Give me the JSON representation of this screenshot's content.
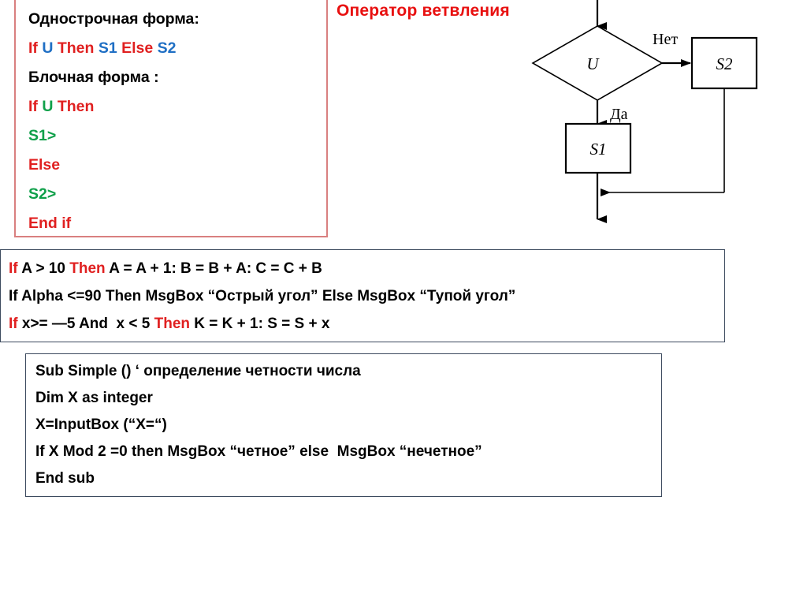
{
  "syntax_box": {
    "border_color": "#d98080",
    "lines": [
      {
        "id": "single-form-heading",
        "tokens": [
          {
            "t": "Однострочная форма:",
            "c": "black"
          }
        ]
      },
      {
        "id": "single-form-code",
        "tokens": [
          {
            "t": "If ",
            "c": "red"
          },
          {
            "t": "U ",
            "c": "blue"
          },
          {
            "t": "Then ",
            "c": "red"
          },
          {
            "t": "S1 ",
            "c": "blue"
          },
          {
            "t": "Else ",
            "c": "red"
          },
          {
            "t": "S2",
            "c": "blue"
          }
        ]
      },
      {
        "id": "block-form-heading",
        "tokens": [
          {
            "t": "Блочная форма :",
            "c": "black"
          }
        ]
      },
      {
        "id": "block-if-then",
        "tokens": [
          {
            "t": "If ",
            "c": "red"
          },
          {
            "t": "U ",
            "c": "green"
          },
          {
            "t": "Then",
            "c": "red"
          }
        ]
      },
      {
        "id": "block-s1",
        "tokens": [
          {
            "t": "S1>",
            "c": "green"
          }
        ]
      },
      {
        "id": "block-else",
        "tokens": [
          {
            "t": "Else",
            "c": "red"
          }
        ]
      },
      {
        "id": "block-s2",
        "tokens": [
          {
            "t": "S2>",
            "c": "green"
          }
        ]
      },
      {
        "id": "block-end-if",
        "tokens": [
          {
            "t": "End if",
            "c": "red"
          }
        ]
      }
    ]
  },
  "flowchart": {
    "title": "Оператор ветвления",
    "title_color": "#e81010",
    "condition_label": "U",
    "true_branch_label": "Да",
    "false_branch_label": "Нет",
    "true_block_label": "S1",
    "false_block_label": "S2",
    "stroke_color": "#000000"
  },
  "examples_box": {
    "border_color": "#3c4a5e",
    "lines": [
      {
        "id": "example-1",
        "tokens": [
          {
            "t": "If ",
            "c": "red"
          },
          {
            "t": "A > 10 ",
            "c": "black"
          },
          {
            "t": "Then ",
            "c": "red"
          },
          {
            "t": "A = A + 1: B = B + A: C = C + B",
            "c": "black"
          }
        ]
      },
      {
        "id": "example-2",
        "tokens": [
          {
            "t": "If Alpha <=90 Then MsgBox “Острый угол” Else MsgBox “Тупой угол”",
            "c": "black"
          }
        ]
      },
      {
        "id": "example-3",
        "tokens": [
          {
            "t": "If ",
            "c": "red"
          },
          {
            "t": "x>= —5 And  x < 5 ",
            "c": "black"
          },
          {
            "t": "Then ",
            "c": "red"
          },
          {
            "t": "K = K + 1: S = S + x",
            "c": "black"
          }
        ]
      }
    ]
  },
  "sub_box": {
    "border_color": "#3c4a5e",
    "lines": [
      {
        "id": "sub-line-1",
        "text": "Sub Simple () ‘ определение четности числа"
      },
      {
        "id": "sub-line-2",
        "text": "Dim X as integer"
      },
      {
        "id": "sub-line-3",
        "text": "X=InputBox (“X=“)"
      },
      {
        "id": "sub-line-4",
        "text": "If X Mod 2 =0 then MsgBox “четное” else  MsgBox “нечетное”"
      },
      {
        "id": "sub-line-5",
        "text": "End sub"
      }
    ]
  }
}
